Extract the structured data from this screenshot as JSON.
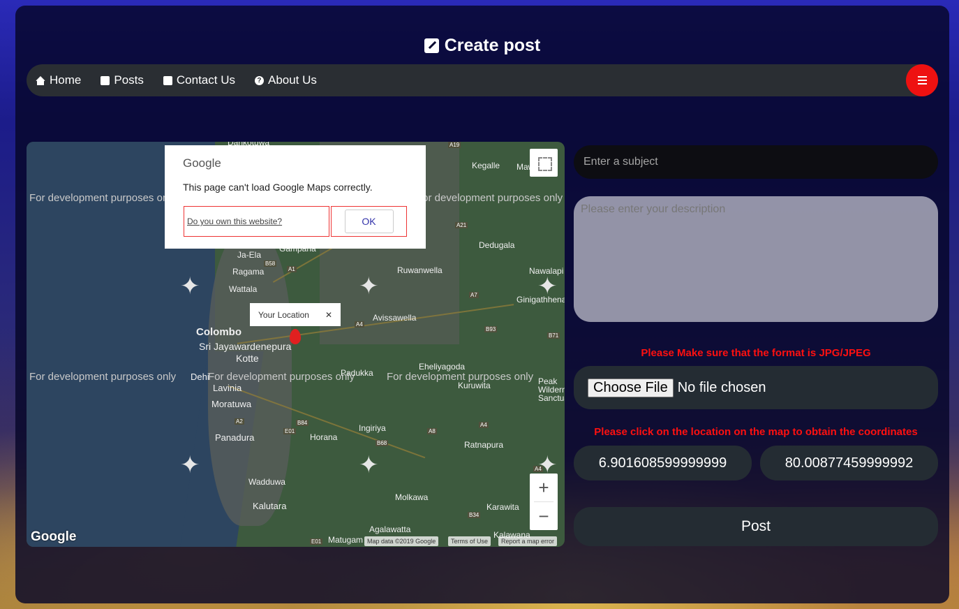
{
  "page": {
    "title": "Create post"
  },
  "nav": {
    "items": [
      {
        "label": "Home",
        "icon": "home-icon"
      },
      {
        "label": "Posts",
        "icon": "edit-icon"
      },
      {
        "label": "Contact Us",
        "icon": "phone-icon"
      },
      {
        "label": "About Us",
        "icon": "question-icon"
      }
    ],
    "menu_icon": "hamburger-menu-icon",
    "menu_color": "#ee1111"
  },
  "map": {
    "dialog": {
      "brand": "Google",
      "message": "This page can't load Google Maps correctly.",
      "own_link": "Do you own this website?",
      "ok_label": "OK"
    },
    "dev_text": "For development purposes only",
    "marker_popup": "Your Location",
    "places": {
      "colombo": "Colombo",
      "sjp": "Sri Jayawardenepura",
      "kotte": "Kotte",
      "wattala": "Wattala",
      "ragama": "Ragama",
      "jaela": "Ja-Ela",
      "gampaha": "Gampaha",
      "ruwanwella": "Ruwanwella",
      "kegalle": "Kegalle",
      "mawanella": "Mawane",
      "dedugala": "Dedugala",
      "nawalapitiya": "Nawalapi",
      "ginigathhena": "Ginigathhena",
      "avissawella": "Avissawella",
      "padukka": "Padukka",
      "eheliyagoda": "Eheliyagoda",
      "kuruwita": "Kuruwita",
      "peak": "Peak",
      "wilderness": "Wilderness",
      "sanctuary": "Sanctuary",
      "dehiwala": "Dehi",
      "lavinia": "Lavinia",
      "moratuwa": "Moratuwa",
      "panadura": "Panadura",
      "horana": "Horana",
      "ingiriya": "Ingiriya",
      "ratnapura": "Ratnapura",
      "wadduwa": "Wadduwa",
      "kalutara": "Kalutara",
      "molkawa": "Molkawa",
      "karawita": "Karawita",
      "agalawatta": "Agalawatta",
      "matugama": "Matugam",
      "kalawana": "Kalawana",
      "dankotuwa": "Dankotuwa"
    },
    "shields": [
      "A19",
      "A21",
      "B58",
      "A1",
      "A7",
      "B93",
      "A4",
      "B71",
      "A2",
      "B84",
      "E01",
      "A8",
      "B68",
      "A4",
      "B34",
      "E01",
      "A4"
    ],
    "attribution": {
      "logo": "Google",
      "mapdata": "Map data ©2019 Google",
      "terms": "Terms of Use",
      "report": "Report a map error"
    },
    "zoom_in": "+",
    "zoom_out": "−"
  },
  "form": {
    "subject_placeholder": "Enter a subject",
    "description_placeholder": "Please enter your description",
    "format_warning": "Please Make sure that the format is JPG/JPEG",
    "choose_file": "Choose File",
    "no_file": "No file chosen",
    "map_warning": "Please click on the location on the map to obtain the coordinates",
    "latitude": "6.901608599999999",
    "longitude": "80.00877459999992",
    "post_label": "Post",
    "warning_color": "#ff1010"
  }
}
